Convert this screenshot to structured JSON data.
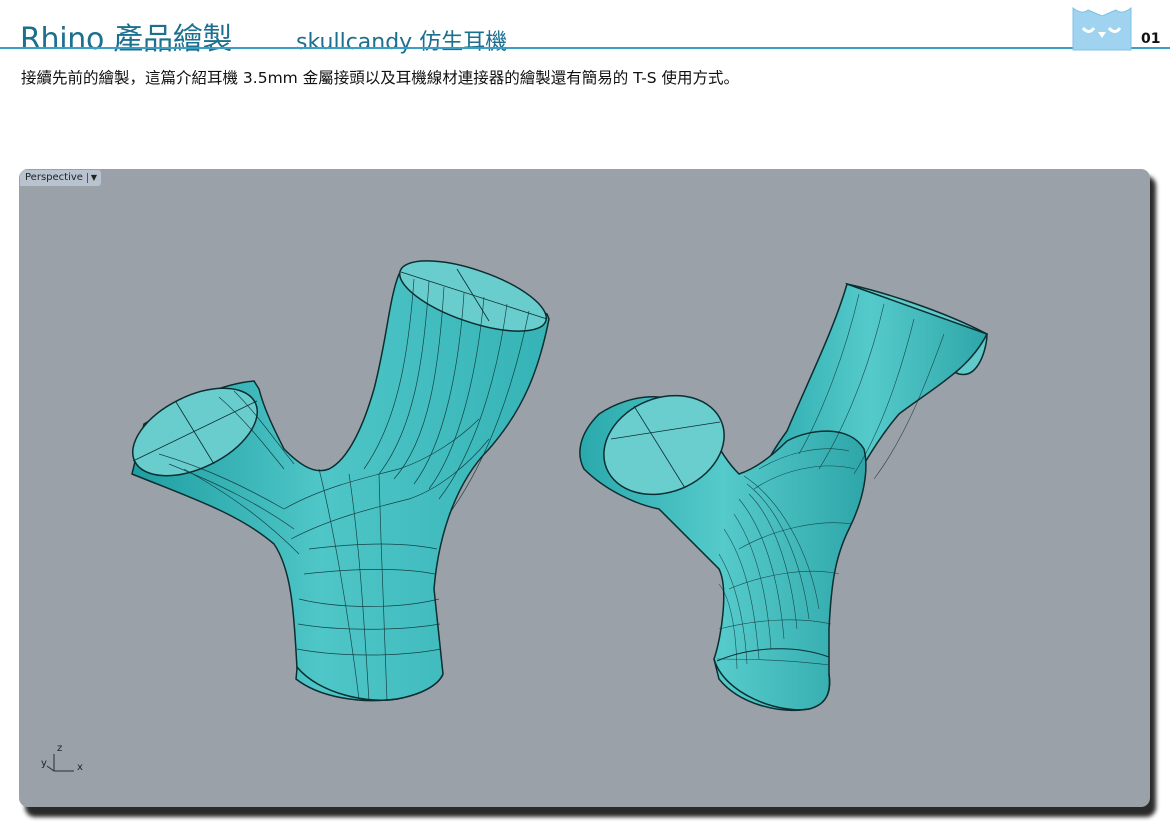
{
  "header": {
    "title": "Rhino 產品繪製",
    "subtitle": "skullcandy 仿生耳機",
    "page_number": "01",
    "logo_icon": "owl-logo-icon"
  },
  "intro": {
    "text": "接續先前的繪製，這篇介紹耳機 3.5mm 金屬接頭以及耳機線材連接器的繪製還有簡易的 T-S 使用方式。"
  },
  "viewport": {
    "name": "Perspective",
    "dropdown_icon": "triangle-down-icon",
    "axis": {
      "z": "z",
      "y": "y",
      "x": "x"
    },
    "background": "#9ba1a9"
  },
  "colors": {
    "title": "#1c6f8e",
    "rule": "#3b9fc5",
    "surface": "#52c7c9",
    "surface_dark": "#1d8f93",
    "surface_light": "#8fe0df"
  }
}
